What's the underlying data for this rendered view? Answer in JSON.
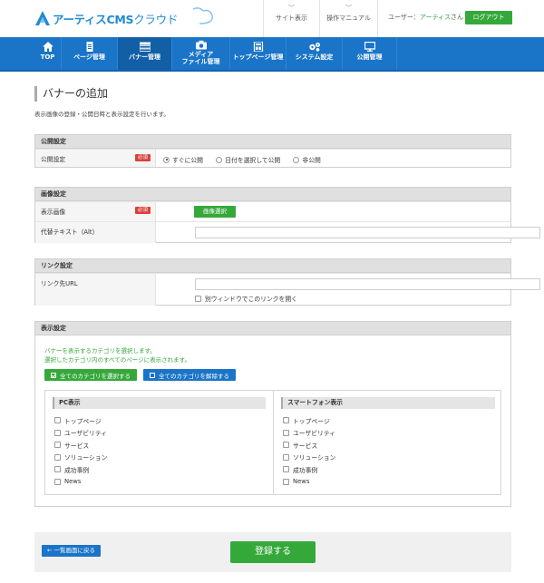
{
  "header": {
    "logo_main": "アーティスCMS",
    "logo_sub": "クラウド",
    "links": [
      {
        "label": "サイト表示"
      },
      {
        "label": "操作マニュアル"
      }
    ],
    "user_prefix": "ユーザー：",
    "user_name": "アーティス",
    "user_suffix": "さん",
    "logout_label": "ログアウト"
  },
  "nav": [
    {
      "label": "TOP",
      "icon": "home-icon"
    },
    {
      "label": "ページ管理",
      "icon": "document-icon"
    },
    {
      "label": "バナー管理",
      "icon": "banner-icon"
    },
    {
      "label1": "メディア",
      "label2": "ファイル管理",
      "icon": "camera-icon"
    },
    {
      "label": "トップページ管理",
      "icon": "layout-icon"
    },
    {
      "label": "システム設定",
      "icon": "gears-icon"
    },
    {
      "label": "公開管理",
      "icon": "monitor-icon"
    }
  ],
  "page": {
    "title": "バナーの追加",
    "description": "表示画像の登録・公開日時と表示設定を行います。"
  },
  "publish": {
    "heading": "公開設定",
    "label": "公開設定",
    "required": "必須",
    "options": [
      "すぐに公開",
      "日付を選択して公開",
      "非公開"
    ],
    "selected": "すぐに公開"
  },
  "image": {
    "heading": "画像設定",
    "display_label": "表示画像",
    "required": "必須",
    "select_button": "画像選択",
    "alt_label": "代替テキスト（Alt）",
    "alt_value": ""
  },
  "link": {
    "heading": "リンク設定",
    "url_label": "リンク先URL",
    "url_value": "",
    "new_window_label": "別ウィンドウでこのリンクを開く"
  },
  "display": {
    "heading": "表示設定",
    "note1": "バナーを表示するカテゴリを選択します。",
    "note2": "選択したカテゴリ内のすべてのページに表示されます。",
    "select_all": "全てのカテゴリを選択する",
    "deselect_all": "全てのカテゴリを解除する",
    "pc_heading": "PC表示",
    "sp_heading": "スマートフォン表示",
    "categories": [
      "トップページ",
      "ユーザビリティ",
      "サービス",
      "ソリューション",
      "成功事例",
      "News"
    ]
  },
  "footer": {
    "back_label": "← 一覧画面に戻る",
    "submit_label": "登録する"
  },
  "colors": {
    "accent_blue": "#1a74c8",
    "accent_green": "#35a83a",
    "required_red": "#d9413a"
  }
}
